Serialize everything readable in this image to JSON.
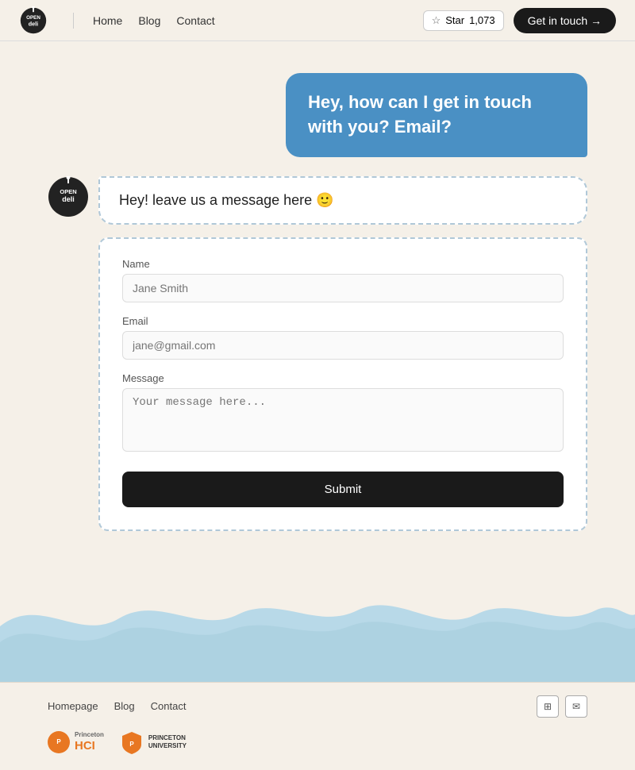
{
  "navbar": {
    "logo_text": "deli",
    "nav_items": [
      "Home",
      "Blog",
      "Contact"
    ],
    "star_label": "Star",
    "star_count": "1,073",
    "cta_label": "Get in touch →"
  },
  "chat": {
    "user_message": "Hey, how can I get in touch with you? Email?",
    "bot_message": "Hey! leave us a message here 🙂"
  },
  "form": {
    "name_label": "Name",
    "name_placeholder": "Jane Smith",
    "email_label": "Email",
    "email_placeholder": "jane@gmail.com",
    "message_label": "Message",
    "message_placeholder": "Your message here...",
    "submit_label": "Submit"
  },
  "footer": {
    "links": [
      "Homepage",
      "Blog",
      "Contact"
    ],
    "social_icons": [
      "grid-icon",
      "envelope-icon"
    ],
    "princeton_hci": "Princeton\nHCI",
    "princeton_university": "PRINCETON\nUNIVERSITY"
  }
}
